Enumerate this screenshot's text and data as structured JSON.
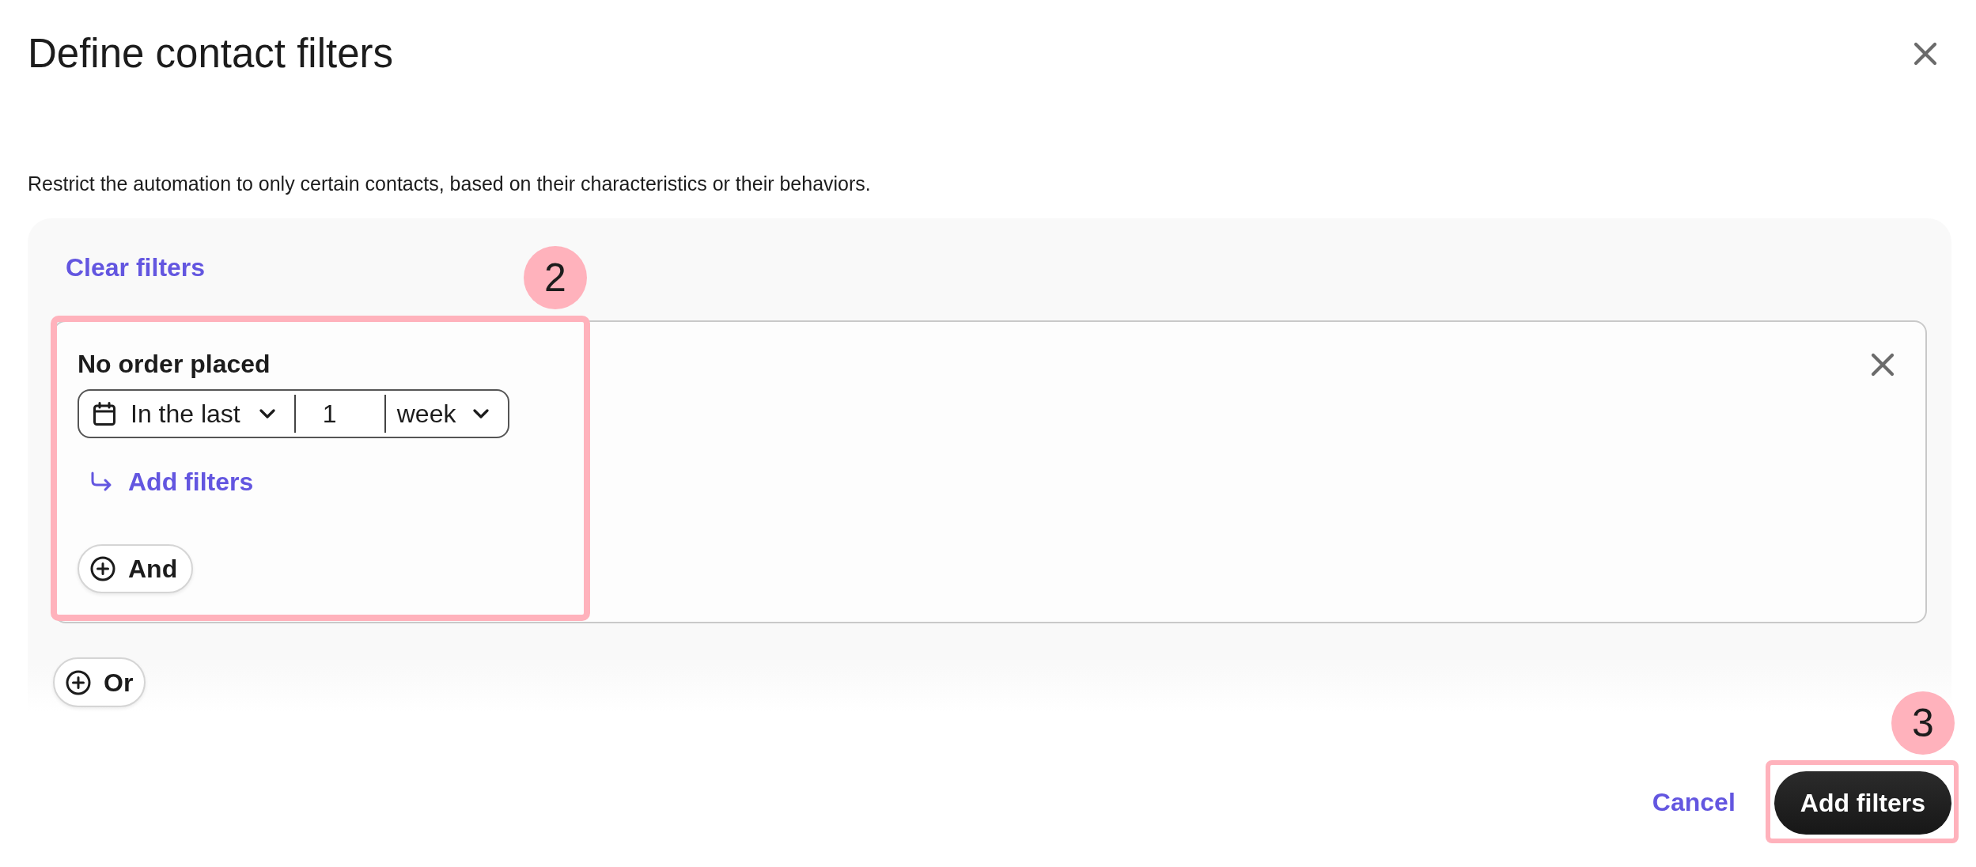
{
  "dialog": {
    "title": "Define contact filters",
    "description": "Restrict the automation to only certain contacts, based on their characteristics or their behaviors."
  },
  "filters": {
    "clear_link": "Clear filters",
    "groups": [
      {
        "conditions": [
          {
            "title": "No order placed",
            "timeframe": {
              "operator": "In the last",
              "amount": "1",
              "unit": "week"
            },
            "add_link": "Add filters",
            "and_button": "And",
            "callout": "2"
          }
        ]
      }
    ],
    "or_button": "Or"
  },
  "footer": {
    "cancel": "Cancel",
    "submit": {
      "label": "Add filters",
      "callout": "3"
    }
  }
}
